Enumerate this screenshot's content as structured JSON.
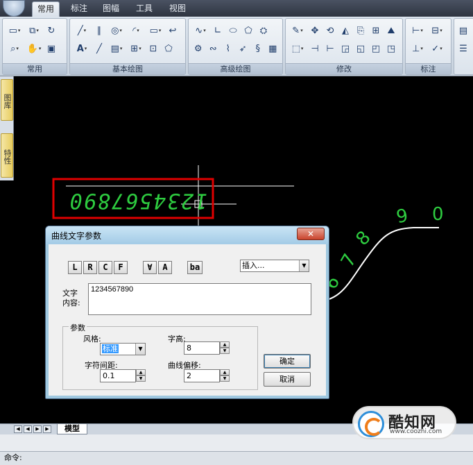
{
  "ribbon": {
    "tabs": [
      {
        "label": "常用",
        "active": true
      },
      {
        "label": "标注",
        "active": false
      },
      {
        "label": "图幅",
        "active": false
      },
      {
        "label": "工具",
        "active": false
      },
      {
        "label": "视图",
        "active": false
      }
    ],
    "groups": [
      {
        "label": "常用"
      },
      {
        "label": "基本绘图"
      },
      {
        "label": "高级绘图"
      },
      {
        "label": "修改"
      },
      {
        "label": "标注"
      }
    ]
  },
  "side_palette": {
    "tabs": [
      "图库",
      "特性"
    ]
  },
  "canvas": {
    "selected_text": "1234567890",
    "curve_digits": [
      "6",
      "7",
      "8",
      "9",
      "0"
    ],
    "colors": {
      "background": "#000000",
      "text": "#2ecc40",
      "curve": "#ffffff",
      "selection_box": "#e00000"
    }
  },
  "dialog": {
    "title": "曲线文字参数",
    "close_label": "✕",
    "align_buttons": [
      "L",
      "R",
      "C",
      "F"
    ],
    "orient_buttons": [
      "∀",
      "A",
      "ba"
    ],
    "insert_select": "插入...",
    "text_label": "文字\n内容:",
    "text_value": "1234567890",
    "params_legend": "参数",
    "style_label": "风格:",
    "style_value": "标准",
    "height_label": "字高:",
    "height_value": "8",
    "spacing_label": "字符间距:",
    "spacing_value": "0.1",
    "offset_label": "曲线偏移:",
    "offset_value": "2",
    "ok_label": "确定",
    "cancel_label": "取消"
  },
  "bottom": {
    "model_tab": "模型",
    "command_label": "命令:"
  },
  "watermark": {
    "name": "酷知网",
    "url": "www.coozhi.com"
  }
}
